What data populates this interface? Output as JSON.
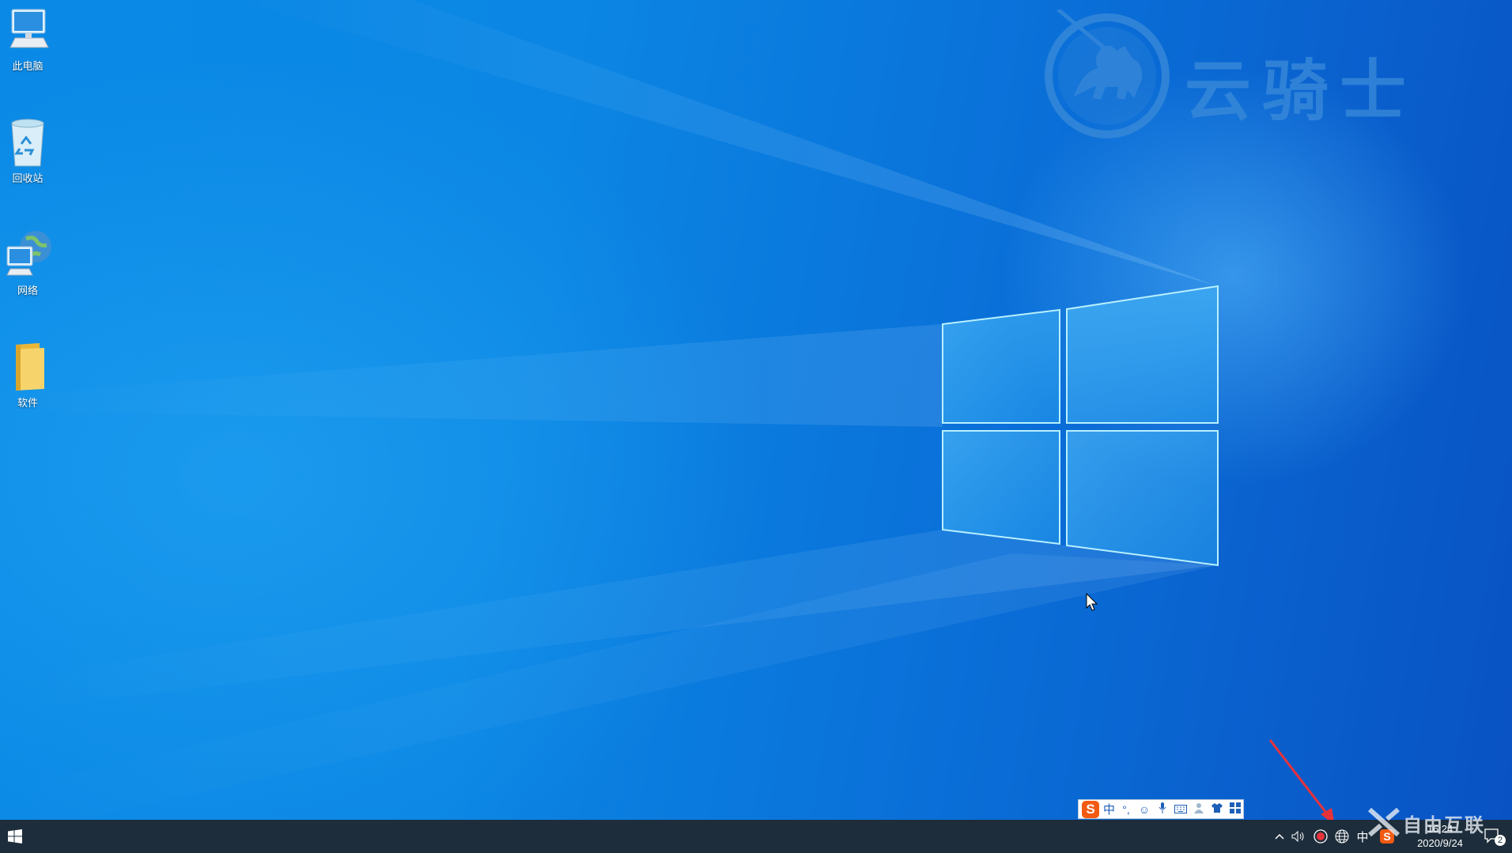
{
  "desktop_icons": [
    {
      "label": "此电脑",
      "icon": "computer-icon"
    },
    {
      "label": "回收站",
      "icon": "recycle-bin-icon"
    },
    {
      "label": "网络",
      "icon": "network-icon"
    },
    {
      "label": "软件",
      "icon": "folder-icon"
    }
  ],
  "watermark": {
    "text": "云骑士",
    "icon": "knight-logo-icon"
  },
  "ime_toolbar": {
    "mode": "中",
    "punct": "°,",
    "icons": [
      "sogou-icon",
      "emoji-icon",
      "microphone-icon",
      "keyboard-icon",
      "user-icon",
      "skin-icon",
      "grid-icon"
    ]
  },
  "taskbar": {
    "start_icon": "windows-icon",
    "tray": {
      "chevron": "^",
      "lang": "中",
      "sogou": "S"
    },
    "clock": {
      "time": "16:24",
      "date": "2020/9/24"
    },
    "notifications": {
      "count": "2"
    }
  },
  "corner_logo": {
    "text": "自由互联"
  },
  "colors": {
    "taskbar": "#1d2d3b",
    "desktop": "#0a86e4",
    "accent_arrow": "#e8323a",
    "sogou": "#f25a12"
  }
}
